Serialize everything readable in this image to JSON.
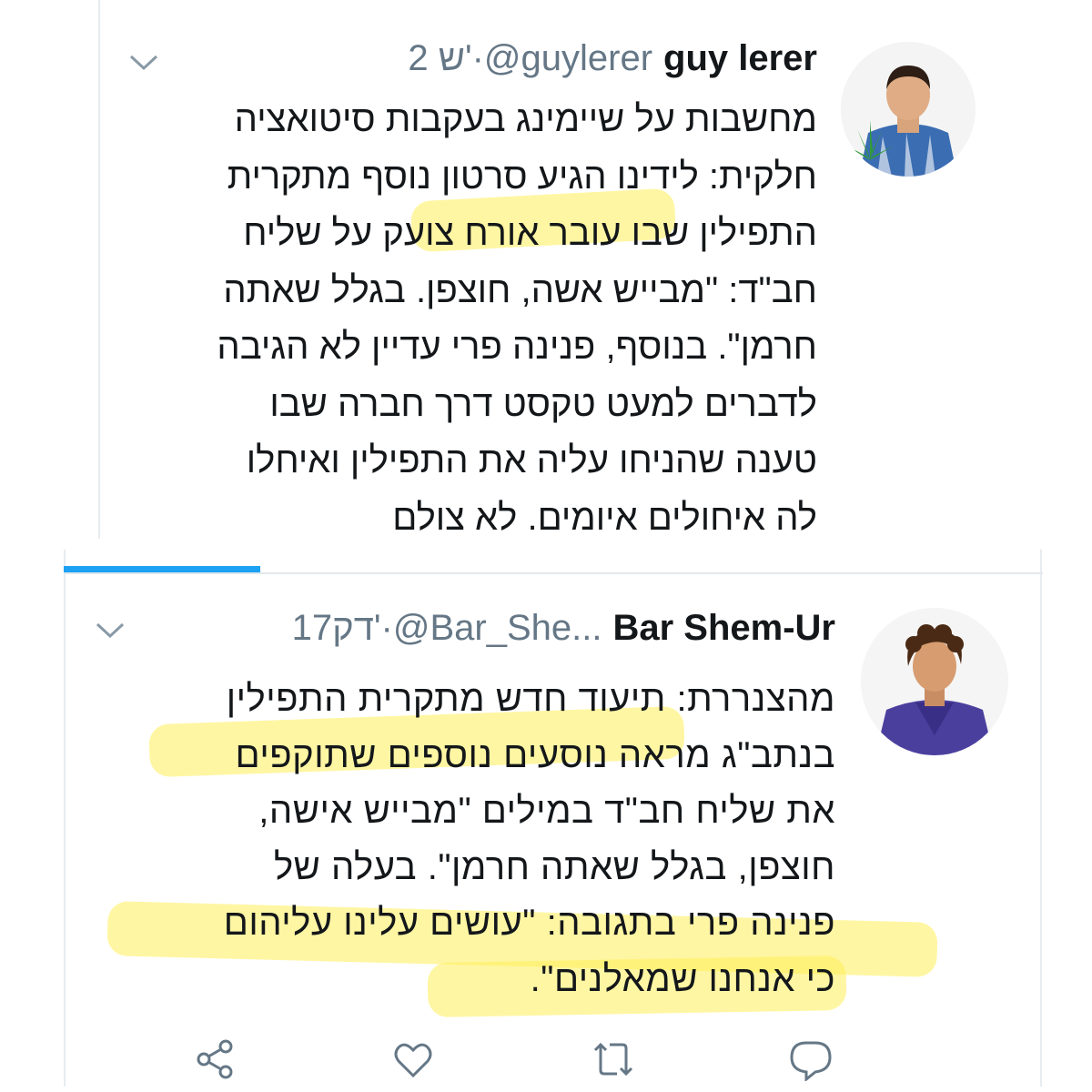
{
  "tweets": [
    {
      "name": "guy lerer",
      "handle": "@guylerer",
      "sep": " · ",
      "time": "2 ש'",
      "body_lines": [
        "מחשבות על שיימינג בעקבות סיטואציה",
        "חלקית: לידינו הגיע סרטון נוסף מתקרית",
        "התפילין שבו עובר אורח צועק על שליח",
        "חב\"ד: \"מבייש אשה, חוצפן. בגלל שאתה",
        "חרמן\". בנוסף, פנינה פרי עדיין לא הגיבה",
        "לדברים למעט טקסט דרך חברה שבו",
        "טענה שהניחו עליה את התפילין ואיחלו",
        "לה איחולים איומים. לא צולם"
      ]
    },
    {
      "name": "Bar Shem-Ur",
      "handle": "@Bar_She...",
      "sep": " · ",
      "time": "17דק'",
      "body_lines": [
        "מהצנררת: תיעוד חדש מתקרית התפילין",
        "בנתב\"ג מראה נוסעים נוספים שתוקפים",
        "את שליח חב\"ד במילים \"מבייש אישה,",
        "חוצפן, בגלל שאתה חרמן\". בעלה של",
        "פנינה פרי בתגובה: \"עושים עלינו עליהום",
        "כי אנחנו שמאלנים\"."
      ]
    }
  ],
  "actions": [
    "share-icon",
    "like-icon",
    "retweet-icon",
    "reply-icon"
  ],
  "colors": {
    "accent": "#1da1f2",
    "text": "#14171a",
    "muted": "#657786",
    "highlight": "#ffee5a"
  }
}
